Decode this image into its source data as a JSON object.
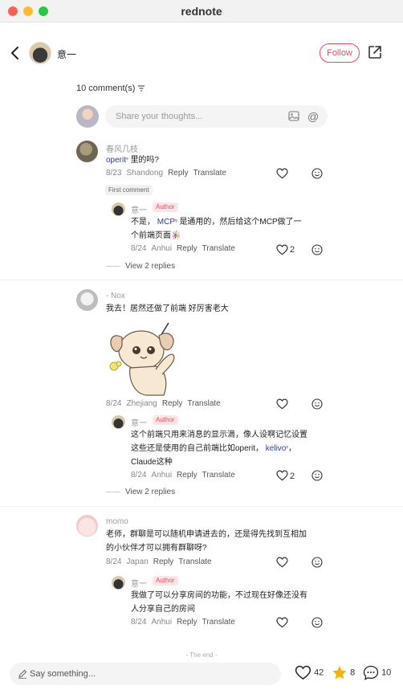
{
  "app": {
    "title": "rednote"
  },
  "header": {
    "author_name": "意一",
    "follow_label": "Follow"
  },
  "comments_header": {
    "count_label": "10 comment(s)"
  },
  "composer": {
    "placeholder": "Share your thoughts..."
  },
  "comments": [
    {
      "user": "春风几枝",
      "link": "operit",
      "text": "里的吗?",
      "date": "8/23",
      "location": "Shandong",
      "reply_label": "Reply",
      "translate_label": "Translate",
      "badge": "First comment",
      "reply": {
        "user": "意一",
        "badge": "Author",
        "line1_pre": "不是，",
        "link": "MCP",
        "line1_post": "是通用的，然后给这个MCP做了一",
        "line2": "个前端页面",
        "date": "8/24",
        "location": "Anhui",
        "reply_label": "Reply",
        "translate_label": "Translate",
        "likes": "2"
      },
      "view_replies": "View 2 replies"
    },
    {
      "user": "- Nox",
      "text": "我去！居然还做了前端 好厉害老大",
      "date": "8/24",
      "location": "Zhejiang",
      "reply_label": "Reply",
      "translate_label": "Translate",
      "reply": {
        "user": "意一",
        "badge": "Author",
        "line1": "这个前端只用来消息的显示滴，像人设啊记忆设置",
        "line2_pre": "这些还是使用的自己前端比如operit，",
        "link": "kelivo",
        "line2_post": "，",
        "line3": "Claude这种",
        "date": "8/24",
        "location": "Anhui",
        "reply_label": "Reply",
        "translate_label": "Translate",
        "likes": "2"
      },
      "view_replies": "View 2 replies"
    },
    {
      "user": "momo",
      "line1": "老师，群聊是可以随机申请进去的，还是得先找到互相加",
      "line2": "的小伙伴才可以拥有群聊呀?",
      "date": "8/24",
      "location": "Japan",
      "reply_label": "Reply",
      "translate_label": "Translate",
      "reply": {
        "user": "意一",
        "badge": "Author",
        "line1": "我做了可以分享房间的功能，不过现在好像还没有",
        "line2": "人分享自己的房间",
        "date": "8/24",
        "location": "Anhui",
        "reply_label": "Reply",
        "translate_label": "Translate"
      }
    }
  ],
  "footer": {
    "the_end": "- The end -"
  },
  "bottom_bar": {
    "placeholder": "Say something...",
    "likes": "42",
    "stars": "8",
    "comments": "10"
  },
  "colors": {
    "accent": "#f0485a",
    "link": "#2f3c8f",
    "star": "#f5b400"
  }
}
